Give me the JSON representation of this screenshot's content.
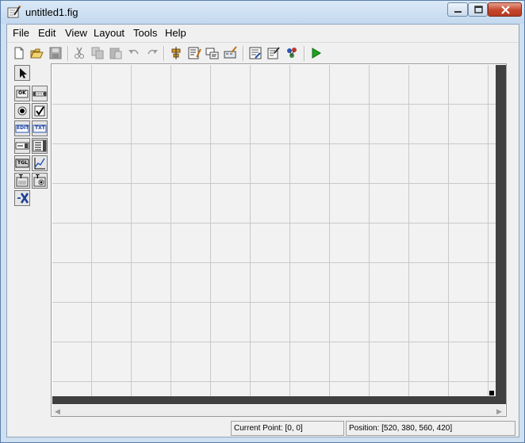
{
  "window": {
    "title": "untitled1.fig",
    "icon": "guide-figure-icon"
  },
  "menubar": {
    "items": [
      "File",
      "Edit",
      "View",
      "Layout",
      "Tools",
      "Help"
    ]
  },
  "toolbar": {
    "buttons": [
      "new-icon",
      "open-icon",
      "save-icon",
      "cut-icon",
      "copy-icon",
      "paste-icon",
      "undo-icon",
      "redo-icon",
      "align-objects-icon",
      "menu-editor-icon",
      "tab-order-editor-icon",
      "toolbar-editor-icon",
      "m-file-editor-icon",
      "property-inspector-icon",
      "object-browser-icon",
      "run-icon"
    ],
    "run_color": "#1fa11f"
  },
  "palette": {
    "items": [
      "select-tool-icon",
      "push-button-icon",
      "slider-icon",
      "radio-button-icon",
      "checkbox-icon",
      "edit-text-icon",
      "static-text-icon",
      "popup-menu-icon",
      "listbox-icon",
      "toggle-button-icon",
      "axes-icon",
      "panel-icon",
      "button-group-icon",
      "activex-control-icon"
    ],
    "labels": {
      "push": "OK",
      "edit": "EDIT",
      "text": "TXT",
      "toggle": "TGL",
      "panel": "T",
      "group": "T"
    }
  },
  "status": {
    "current_point": "Current Point: [0, 0]",
    "position": "Position: [520, 380, 560, 420]"
  },
  "colors": {
    "title_bg": "#c8dbef",
    "grid_bg": "#f2f2f2",
    "grid_line": "#c9c9c9",
    "layout_border": "#404040",
    "close_red": "#c6452b"
  }
}
